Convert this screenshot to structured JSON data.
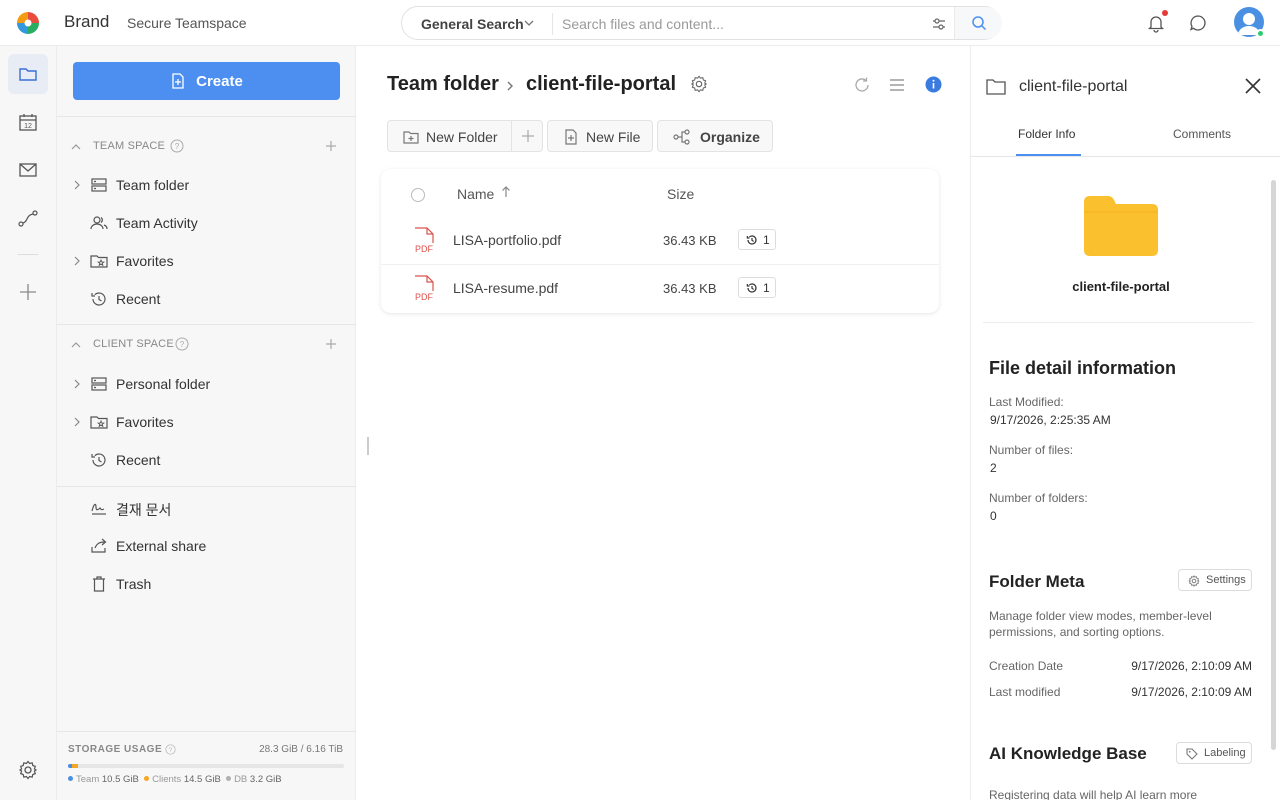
{
  "header": {
    "brand": "Brand",
    "subtitle": "Secure Teamspace",
    "search_scope": "General Search",
    "search_placeholder": "Search files and content...",
    "icons": [
      "bell-icon",
      "chat-icon",
      "user-avatar"
    ]
  },
  "rail": {
    "items": [
      "folder-icon",
      "calendar-icon",
      "mail-icon",
      "workflow-icon",
      "plus-icon"
    ],
    "calendar_day": "12",
    "footer_icon": "settings-gear-icon"
  },
  "sidebar": {
    "create_label": "Create",
    "team_space": {
      "title": "TEAM SPACE",
      "items": [
        {
          "label": "Team folder",
          "icon": "server-icon"
        },
        {
          "label": "Team Activity",
          "icon": "people-icon"
        },
        {
          "label": "Favorites",
          "icon": "star-folder-icon"
        },
        {
          "label": "Recent",
          "icon": "history-icon"
        }
      ]
    },
    "client_space": {
      "title": "CLIENT SPACE",
      "items": [
        {
          "label": "Personal folder",
          "icon": "server-icon"
        },
        {
          "label": "Favorites",
          "icon": "star-folder-icon"
        },
        {
          "label": "Recent",
          "icon": "history-icon"
        }
      ]
    },
    "extra_items": [
      {
        "label": "결재 문서",
        "icon": "signature-icon"
      },
      {
        "label": "External share",
        "icon": "share-icon"
      },
      {
        "label": "Trash",
        "icon": "trash-icon"
      }
    ],
    "storage": {
      "label": "STORAGE USAGE",
      "total": "28.3 GiB / 6.16 TiB",
      "team_label": "Team",
      "team_value": "10.5 GiB",
      "clients_label": "Clients",
      "clients_value": "14.5 GiB",
      "db_label": "DB",
      "db_value": "3.2 GiB",
      "used_fraction": 0.0045,
      "colors": {
        "team": "#4a90e2",
        "clients": "#f5a623",
        "db": "#b0b0b0"
      }
    }
  },
  "main": {
    "breadcrumb_root": "Team folder",
    "breadcrumb_current": "client-file-portal",
    "toolbar": {
      "new_folder": "New Folder",
      "new_file": "New File",
      "organize": "Organize"
    },
    "table": {
      "col_name": "Name",
      "col_size": "Size",
      "rows": [
        {
          "name": "LISA-portfolio.pdf",
          "size": "36.43 KB",
          "versions": "1",
          "type": "PDF"
        },
        {
          "name": "LISA-resume.pdf",
          "size": "36.43 KB",
          "versions": "1",
          "type": "PDF"
        }
      ]
    }
  },
  "panel": {
    "title": "client-file-portal",
    "tabs": [
      "Folder Info",
      "Comments"
    ],
    "folder_name": "client-file-portal",
    "folder_color": "#fbc02d",
    "file_detail": {
      "heading": "File detail information",
      "last_modified_label": "Last Modified:",
      "last_modified_value": "9/17/2026, 2:25:35 AM",
      "files_label": "Number of files:",
      "files_value": "2",
      "folders_label": "Number of folders:",
      "folders_value": "0"
    },
    "folder_meta": {
      "heading": "Folder Meta",
      "settings_label": "Settings",
      "description": "Manage folder view modes, member-level permissions, and sorting options.",
      "creation_label": "Creation Date",
      "creation_value": "9/17/2026, 2:10:09 AM",
      "modified_label": "Last modified",
      "modified_value": "9/17/2026, 2:10:09 AM"
    },
    "ai": {
      "heading": "AI Knowledge Base",
      "labeling_label": "Labeling",
      "description": "Registering data will help AI learn more"
    }
  },
  "colors": {
    "accent": "#4d8ff0",
    "pdf": "#d9534f",
    "online": "#2ecc71",
    "alert": "#e53935"
  }
}
